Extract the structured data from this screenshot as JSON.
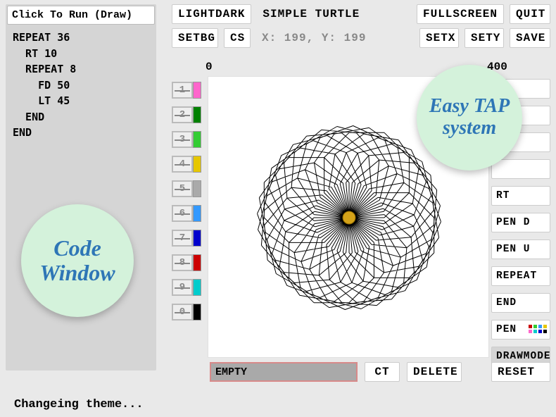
{
  "run_label": "Click To Run (Draw)",
  "code": "REPEAT 36\n  RT 10\n  REPEAT 8\n    FD 50\n    LT 45\n  END\nEND",
  "top": {
    "lightdark": "LIGHTDARK",
    "fullscreen": "FULLSCREEN",
    "quit": "QUIT",
    "setbg": "SETBG",
    "cs": "CS",
    "setx": "SETX",
    "sety": "SETY",
    "save": "SAVE"
  },
  "title": "SIMPLE TURTLE",
  "coords": "X: 199, Y: 199",
  "scale": {
    "min": "0",
    "max": "400"
  },
  "palette": [
    {
      "n": "1",
      "color": "#FF66CC"
    },
    {
      "n": "2",
      "color": "#008000"
    },
    {
      "n": "3",
      "color": "#33CC33"
    },
    {
      "n": "4",
      "color": "#E6C700"
    },
    {
      "n": "5",
      "color": "#AAAAAA"
    },
    {
      "n": "6",
      "color": "#3399FF"
    },
    {
      "n": "7",
      "color": "#0000CC"
    },
    {
      "n": "8",
      "color": "#CC0000"
    },
    {
      "n": "9",
      "color": "#00CCCC"
    },
    {
      "n": "0",
      "color": "#000000"
    }
  ],
  "cmds": {
    "blank1": "",
    "blank2": "",
    "blank3": "",
    "blank4": "",
    "rt": "RT",
    "pend": "PEN D",
    "penu": "PEN U",
    "repeat": "REPEAT",
    "end": "END",
    "pen": "PEN",
    "drawmode": "DRAWMODE"
  },
  "bottom": {
    "empty": "EMPTY",
    "ct": "CT",
    "delete": "DELETE",
    "reset": "RESET"
  },
  "status": "Changeing theme...",
  "bubble_code": "Code Window",
  "bubble_easy": "Easy TAP system",
  "pen_colors": [
    "#CC0000",
    "#33CC33",
    "#3399FF",
    "#E6C700",
    "#FF66CC",
    "#00CCCC",
    "#0000CC",
    "#000000"
  ]
}
